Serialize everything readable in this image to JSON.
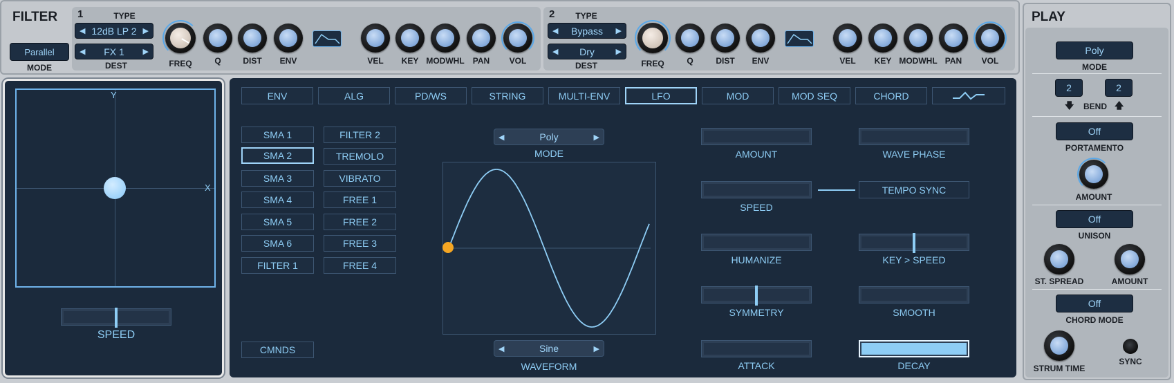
{
  "filter": {
    "title": "FILTER",
    "mode_value": "Parallel",
    "mode_label": "MODE",
    "f1": {
      "num": "1",
      "type_label": "TYPE",
      "type_value": "12dB LP 2",
      "dest_value": "FX 1",
      "dest_label": "DEST"
    },
    "f2": {
      "num": "2",
      "type_label": "TYPE",
      "type_value": "Bypass",
      "dest_value": "Dry",
      "dest_label": "DEST"
    },
    "knobs": {
      "freq": "FREQ",
      "q": "Q",
      "dist": "DIST",
      "env": "ENV",
      "vel": "VEL",
      "key": "KEY",
      "modwhl": "MODWHL",
      "pan": "PAN",
      "vol": "VOL"
    }
  },
  "xy": {
    "y_label": "Y",
    "x_label": "X",
    "speed_label": "SPEED"
  },
  "tabs": [
    "ENV",
    "ALG",
    "PD/WS",
    "STRING",
    "MULTI-ENV",
    "LFO",
    "MOD",
    "MOD SEQ",
    "CHORD"
  ],
  "active_tab": "LFO",
  "lfo_list_left": [
    "SMA 1",
    "SMA 2",
    "SMA 3",
    "SMA 4",
    "SMA 5",
    "SMA 6",
    "FILTER 1"
  ],
  "lfo_list_right": [
    "FILTER 2",
    "TREMOLO",
    "VIBRATO",
    "FREE 1",
    "FREE 2",
    "FREE 3",
    "FREE 4"
  ],
  "cmnds_label": "CMNDS",
  "lfo": {
    "mode_value": "Poly",
    "mode_label": "MODE",
    "waveform_value": "Sine",
    "waveform_label": "WAVEFORM",
    "params": {
      "amount": "AMOUNT",
      "wave_phase": "WAVE PHASE",
      "speed": "SPEED",
      "tempo_sync": "TEMPO SYNC",
      "humanize": "HUMANIZE",
      "key_speed": "KEY > SPEED",
      "symmetry": "SYMMETRY",
      "smooth": "SMOOTH",
      "attack": "ATTACK",
      "decay": "DECAY"
    }
  },
  "play": {
    "title": "PLAY",
    "mode_value": "Poly",
    "mode_label": "MODE",
    "bend_down": "2",
    "bend_up": "2",
    "bend_label": "BEND",
    "portamento_value": "Off",
    "portamento_label": "PORTAMENTO",
    "amount_label": "AMOUNT",
    "unison_value": "Off",
    "unison_label": "UNISON",
    "st_spread_label": "ST. SPREAD",
    "unison_amount_label": "AMOUNT",
    "chord_mode_value": "Off",
    "chord_mode_label": "CHORD MODE",
    "strum_time_label": "STRUM TIME",
    "sync_label": "SYNC"
  },
  "colors": {
    "accent": "#8ecdf5",
    "panel": "#1b2a3c",
    "marker": "#f39c12"
  }
}
